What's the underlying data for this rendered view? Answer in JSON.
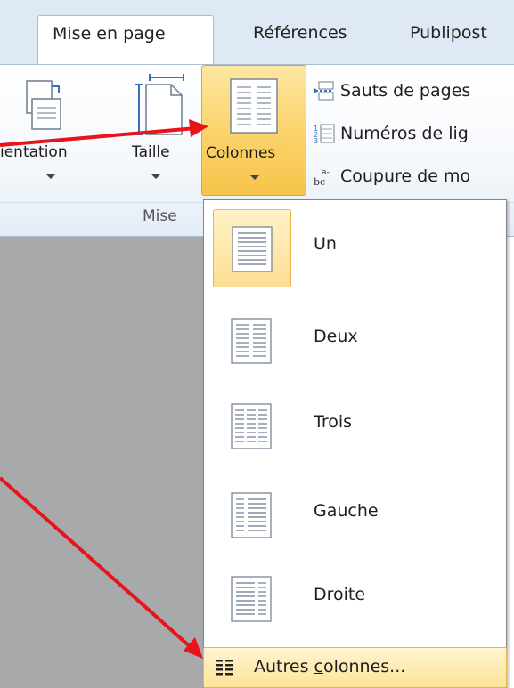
{
  "tabs": {
    "active": "Mise en page",
    "references": "Références",
    "publipostage": "Publipost"
  },
  "ribbon": {
    "orientation_label": "ientation",
    "taille_label": "Taille",
    "colonnes_label": "Colonnes",
    "group_label": "Mise",
    "sauts_label": "Sauts de pages",
    "numeros_label": "Numéros de lig",
    "coupure_label": "Coupure de mo"
  },
  "menu": {
    "items": [
      {
        "label": "Un",
        "icon": "one-column-icon",
        "selected": true
      },
      {
        "label": "Deux",
        "icon": "two-columns-icon",
        "selected": false
      },
      {
        "label": "Trois",
        "icon": "three-columns-icon",
        "selected": false
      },
      {
        "label": "Gauche",
        "icon": "left-column-icon",
        "selected": false
      },
      {
        "label": "Droite",
        "icon": "right-column-icon",
        "selected": false
      }
    ],
    "more_columns_prefix": "Autres ",
    "more_columns_accel": "c",
    "more_columns_suffix": "olonnes..."
  },
  "colors": {
    "arrow": "#e8141c",
    "highlight": "#fbd46d",
    "tab_bar": "#dfe9f5"
  }
}
